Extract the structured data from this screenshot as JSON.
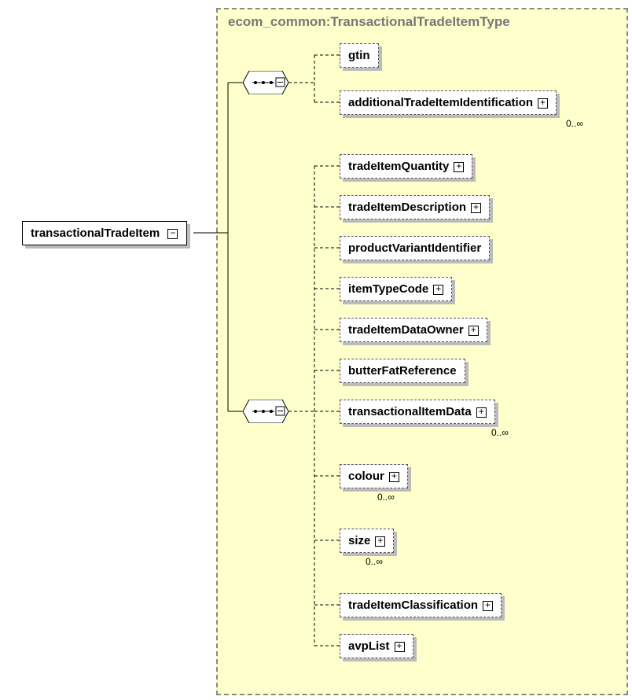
{
  "typeName": "ecom_common:TransactionalTradeItemType",
  "root": {
    "label": "transactionalTradeItem"
  },
  "seq1": {
    "items": [
      {
        "label": "gtin",
        "expand": false,
        "occ": null
      },
      {
        "label": "additionalTradeItemIdentification",
        "expand": true,
        "occ": "0..∞"
      }
    ]
  },
  "seq2": {
    "items": [
      {
        "label": "tradeItemQuantity",
        "expand": true,
        "occ": null
      },
      {
        "label": "tradeItemDescription",
        "expand": true,
        "occ": null
      },
      {
        "label": "productVariantIdentifier",
        "expand": false,
        "occ": null
      },
      {
        "label": "itemTypeCode",
        "expand": true,
        "occ": null
      },
      {
        "label": "tradeItemDataOwner",
        "expand": true,
        "occ": null
      },
      {
        "label": "butterFatReference",
        "expand": false,
        "occ": null
      },
      {
        "label": "transactionalItemData",
        "expand": true,
        "occ": "0..∞"
      },
      {
        "label": "colour",
        "expand": true,
        "occ": "0..∞"
      },
      {
        "label": "size",
        "expand": true,
        "occ": "0..∞"
      },
      {
        "label": "tradeItemClassification",
        "expand": true,
        "occ": null
      },
      {
        "label": "avpList",
        "expand": true,
        "occ": null
      }
    ]
  }
}
